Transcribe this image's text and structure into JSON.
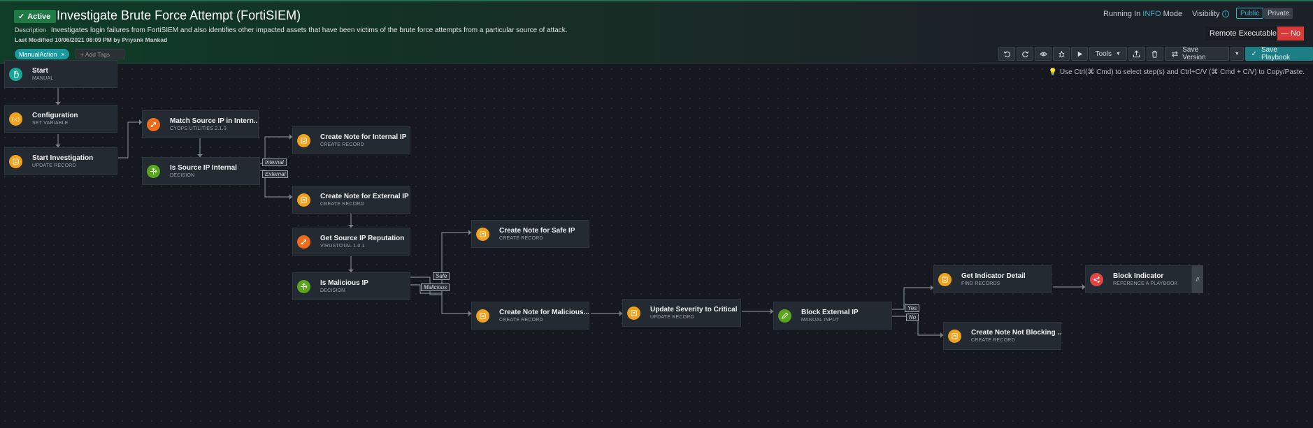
{
  "header": {
    "status": "Active",
    "title": "Investigate Brute Force Attempt (FortiSIEM)",
    "description_label": "Description",
    "description": "Investigates login failures from FortiSIEM and also identifies other impacted assets that have been victims of the brute force attempts from a particular source of attack.",
    "last_modified": "Last Modified 10/06/2021 08:09 PM by Priyank Mankad",
    "tag": "ManualAction",
    "add_tags_placeholder": "+ Add Tags",
    "running_in_prefix": "Running In",
    "running_mode": "INFO",
    "running_suffix": "Mode",
    "visibility_label": "Visibility",
    "visibility_public": "Public",
    "visibility_private": "Private",
    "remote_executable_label": "Remote Executable",
    "remote_executable_value": "— No"
  },
  "toolbar": {
    "tools": "Tools",
    "save_version": "Save Version",
    "save_playbook": "Save Playbook"
  },
  "canvas": {
    "hint": "Use Ctrl(⌘ Cmd) to select step(s) and Ctrl+C/V (⌘ Cmd + C/V) to Copy/Paste."
  },
  "steps": {
    "start": {
      "name": "Start",
      "type": "MANUAL"
    },
    "configuration": {
      "name": "Configuration",
      "type": "SET VARIABLE"
    },
    "start_investigation": {
      "name": "Start Investigation",
      "type": "UPDATE RECORD"
    },
    "match_source_ip": {
      "name": "Match Source IP in Intern...",
      "type": "CYOPS UTILITIES 2.1.0"
    },
    "is_source_ip_internal": {
      "name": "Is Source IP Internal",
      "type": "DECISION"
    },
    "note_internal_ip": {
      "name": "Create Note for Internal IP",
      "type": "CREATE RECORD"
    },
    "note_external_ip": {
      "name": "Create Note for External IP",
      "type": "CREATE RECORD"
    },
    "get_source_ip_reputation": {
      "name": "Get Source IP Reputation",
      "type": "VIRUSTOTAL 1.0.1"
    },
    "is_malicious_ip": {
      "name": "Is Malicious IP",
      "type": "DECISION"
    },
    "note_safe_ip": {
      "name": "Create Note for Safe IP",
      "type": "CREATE RECORD"
    },
    "note_malicious": {
      "name": "Create Note for Malicious...",
      "type": "CREATE RECORD"
    },
    "update_severity": {
      "name": "Update Severity to Critical",
      "type": "UPDATE RECORD"
    },
    "block_external_ip": {
      "name": "Block External IP",
      "type": "MANUAL INPUT"
    },
    "get_indicator_detail": {
      "name": "Get Indicator Detail",
      "type": "FIND RECORDS"
    },
    "block_indicator": {
      "name": "Block Indicator",
      "type": "REFERENCE A PLAYBOOK"
    },
    "note_not_blocking": {
      "name": "Create Note Not Blocking ...",
      "type": "CREATE RECORD"
    }
  },
  "edge_labels": {
    "internal": "Internal",
    "external": "External",
    "safe": "Safe",
    "malicious": "Malicious",
    "yes": "Yes",
    "no": "No"
  },
  "colors": {
    "accent": "#1d7f84",
    "active_badge": "#1e7b44",
    "danger": "#d83a3a",
    "tag": "#1a9aa0"
  }
}
